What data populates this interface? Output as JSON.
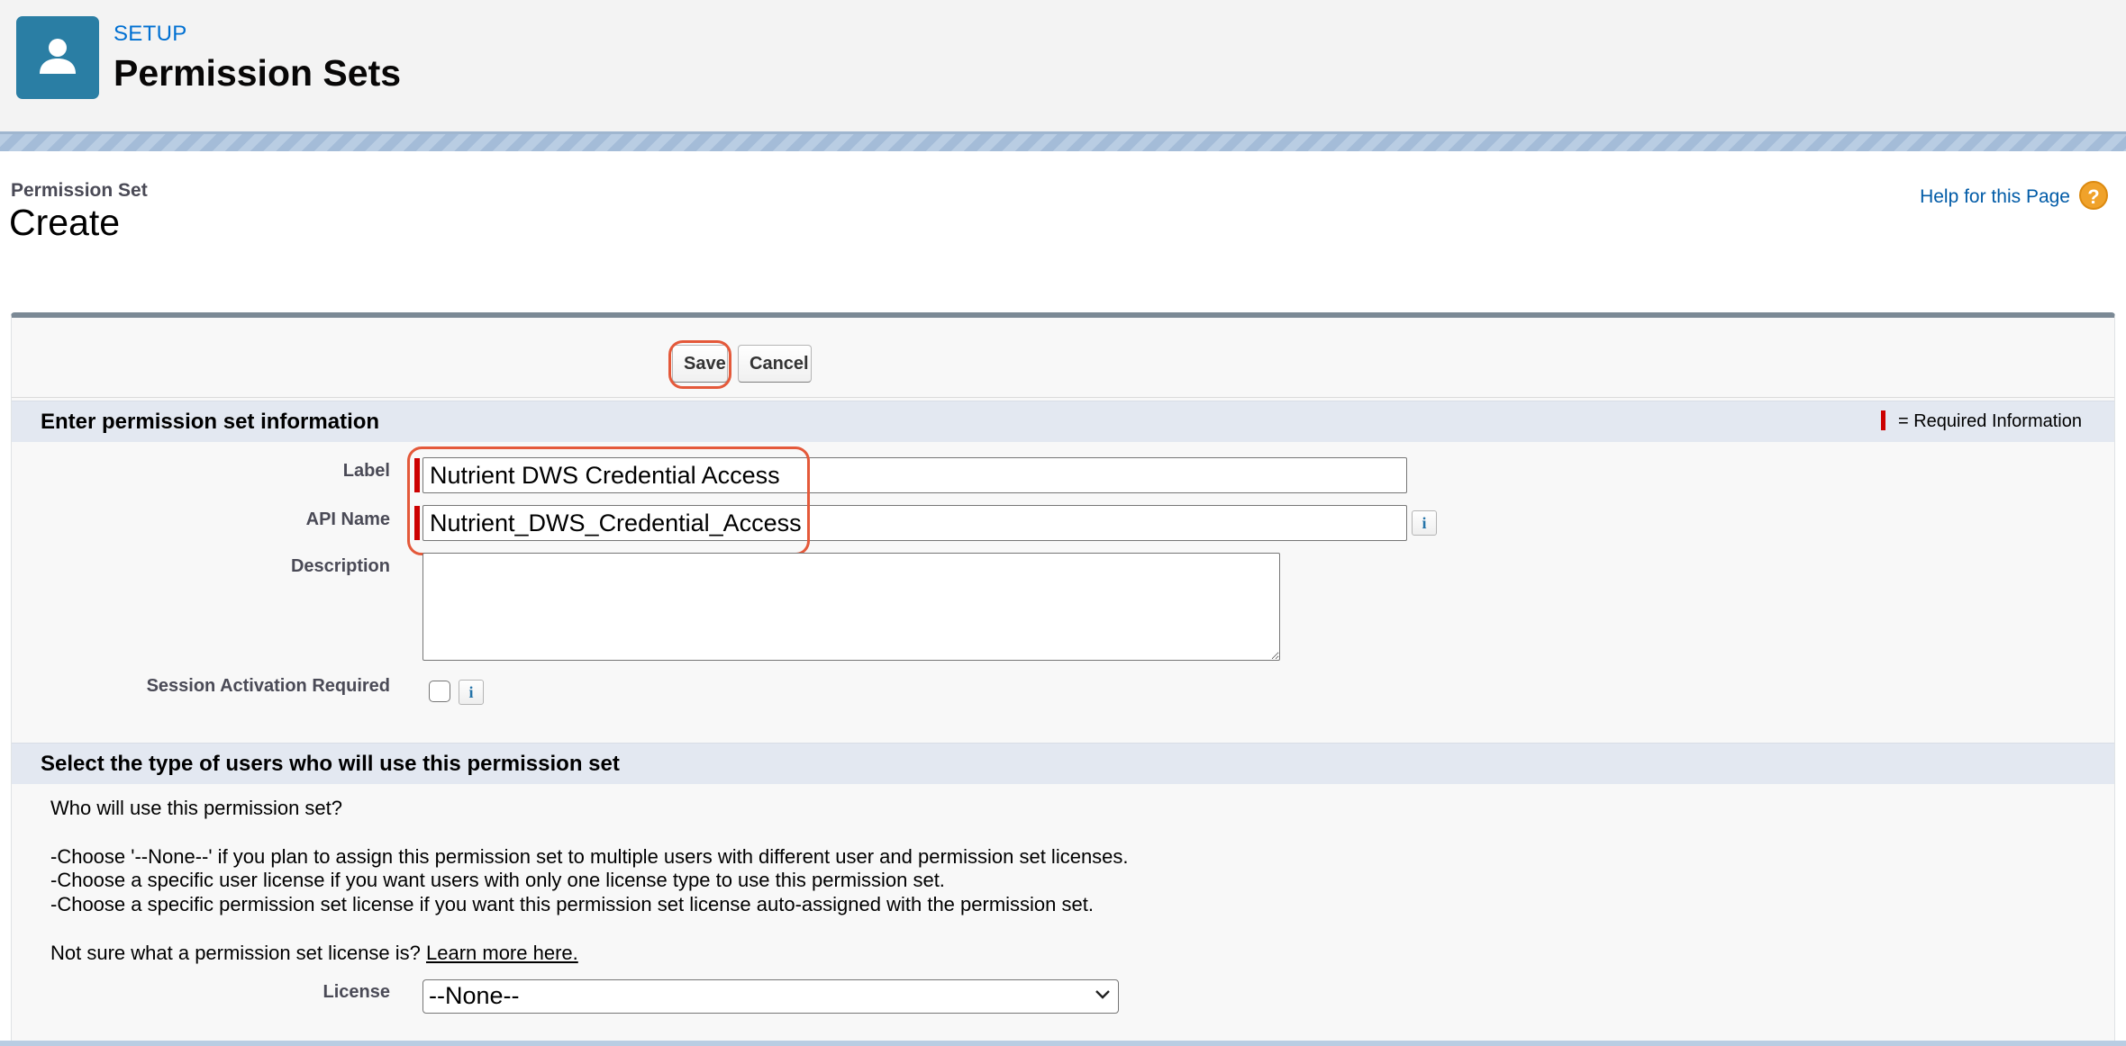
{
  "setup_header": {
    "kicker": "SETUP",
    "title": "Permission Sets",
    "icon": "user-icon",
    "icon_bg": "#2a7ea4"
  },
  "page_header": {
    "kicker": "Permission Set",
    "title": "Create",
    "help_link": "Help for this Page",
    "help_icon": "?"
  },
  "toolbar": {
    "save_label": "Save",
    "cancel_label": "Cancel"
  },
  "section_info": {
    "title": "Enter permission set information",
    "required_legend": "= Required Information"
  },
  "fields": {
    "label": {
      "label": "Label",
      "value": "Nutrient DWS Credential Access"
    },
    "api_name": {
      "label": "API Name",
      "value": "Nutrient_DWS_Credential_Access",
      "info": "i"
    },
    "description": {
      "label": "Description",
      "value": ""
    },
    "session_activation": {
      "label": "Session Activation Required",
      "checked": false,
      "info": "i"
    }
  },
  "section_users": {
    "title": "Select the type of users who will use this permission set",
    "question": "Who will use this permission set?",
    "options": [
      "-Choose '--None--' if you plan to assign this permission set to multiple users with different user and permission set licenses.",
      "-Choose a specific user license if you want users with only one license type to use this permission set.",
      "-Choose a specific permission set license if you want this permission set license auto-assigned with the permission set."
    ],
    "not_sure": "Not sure what a permission set license is?",
    "learn_more": "Learn more here."
  },
  "license": {
    "label": "License",
    "selected": "--None--"
  },
  "colors": {
    "accent_link": "#015ba7",
    "required": "#cc0000",
    "highlight": "#e4593a",
    "help_icon": "#f0a22a"
  }
}
